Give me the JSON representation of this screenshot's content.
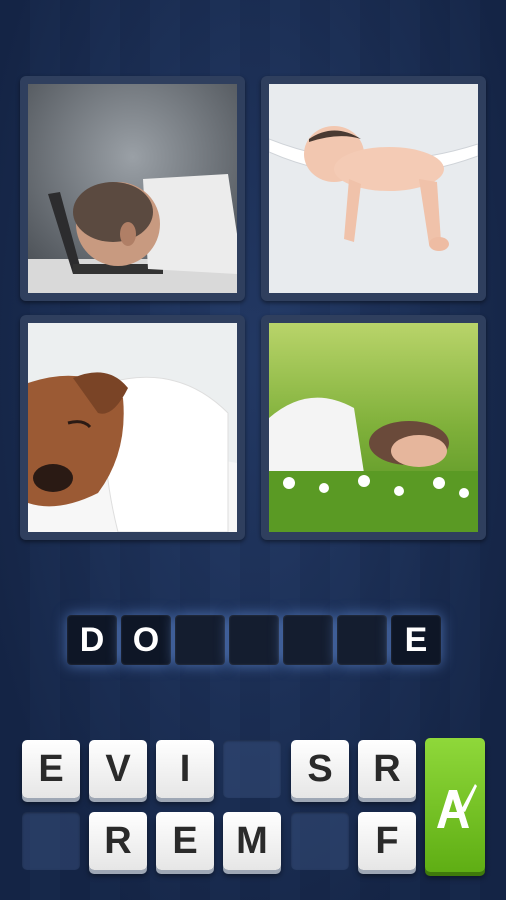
{
  "answer": {
    "slots": [
      "D",
      "O",
      "",
      "",
      "",
      "",
      "E"
    ]
  },
  "keyboard": {
    "row1": [
      "E",
      "V",
      "I",
      "",
      "S",
      "R"
    ],
    "row2": [
      "",
      "R",
      "E",
      "M",
      "",
      "F"
    ]
  },
  "pictures": [
    {
      "id": "man-on-laptop-icon"
    },
    {
      "id": "baby-in-hammock-icon"
    },
    {
      "id": "dog-in-bed-icon"
    },
    {
      "id": "woman-in-grass-icon"
    }
  ],
  "hint_button": {
    "icon": "paintbrush-a-icon",
    "color": "#6fc21e"
  }
}
